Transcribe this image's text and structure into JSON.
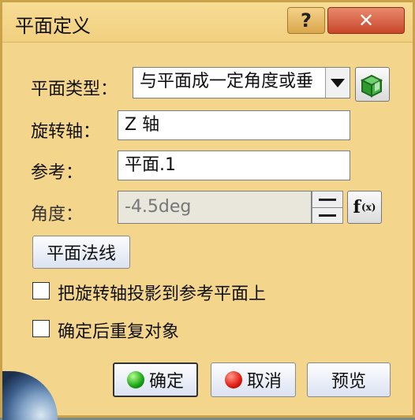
{
  "window": {
    "title": "平面定义",
    "help_label": "?",
    "close_label": "✕"
  },
  "plane_type": {
    "label": "平面类型：",
    "value": "与平面成一定角度或垂"
  },
  "rotation_axis": {
    "label": "旋转轴：",
    "value": "Z 轴"
  },
  "reference": {
    "label": "参考：",
    "value": "平面.1"
  },
  "angle": {
    "label": "角度：",
    "value": "-4.5deg"
  },
  "normal_button": {
    "label": "平面法线"
  },
  "options": {
    "project_axis": {
      "label": "把旋转轴投影到参考平面上",
      "checked": false
    },
    "repeat_object": {
      "label": "确定后重复对象",
      "checked": false
    }
  },
  "footer": {
    "ok_label": "确定",
    "cancel_label": "取消",
    "preview_label": "预览"
  },
  "icons": [
    "cube-icon",
    "formula-icon",
    "ok-dot-icon",
    "cancel-dot-icon"
  ]
}
